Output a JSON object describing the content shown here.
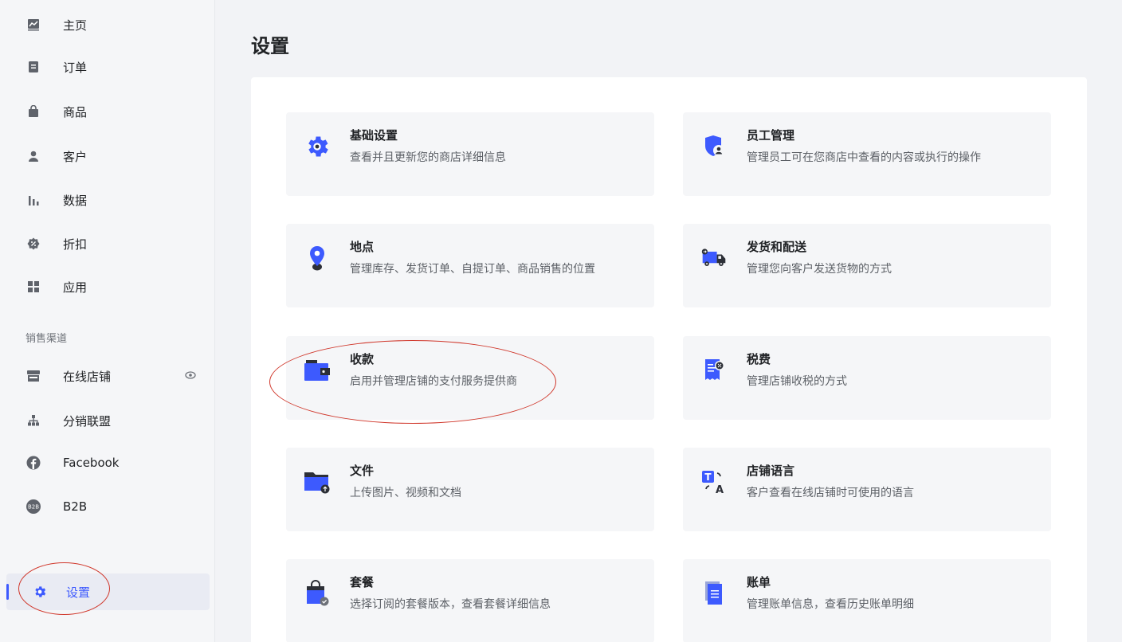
{
  "sidebar": {
    "items": [
      {
        "label": "主页",
        "icon": "chart-icon"
      },
      {
        "label": "订单",
        "icon": "order-icon"
      },
      {
        "label": "商品",
        "icon": "bag-icon"
      },
      {
        "label": "客户",
        "icon": "user-icon"
      },
      {
        "label": "数据",
        "icon": "bar-chart-icon"
      },
      {
        "label": "折扣",
        "icon": "discount-icon"
      },
      {
        "label": "应用",
        "icon": "apps-icon"
      }
    ],
    "section_label": "销售渠道",
    "channels": [
      {
        "label": "在线店铺",
        "icon": "store-icon"
      },
      {
        "label": "分销联盟",
        "icon": "affiliate-icon"
      },
      {
        "label": "Facebook",
        "icon": "facebook-icon"
      },
      {
        "label": "B2B",
        "icon": "b2b-icon"
      }
    ],
    "settings_label": "设置"
  },
  "main": {
    "title": "设置",
    "cards": [
      {
        "title": "基础设置",
        "desc": "查看并且更新您的商店详细信息",
        "icon": "gear-icon"
      },
      {
        "title": "员工管理",
        "desc": "管理员工可在您商店中查看的内容或执行的操作",
        "icon": "staff-shield-icon"
      },
      {
        "title": "地点",
        "desc": "管理库存、发货订单、自提订单、商品销售的位置",
        "icon": "location-pin-icon"
      },
      {
        "title": "发货和配送",
        "desc": "管理您向客户发送货物的方式",
        "icon": "truck-icon"
      },
      {
        "title": "收款",
        "desc": "启用并管理店铺的支付服务提供商",
        "icon": "wallet-icon"
      },
      {
        "title": "税费",
        "desc": "管理店铺收税的方式",
        "icon": "tax-receipt-icon"
      },
      {
        "title": "文件",
        "desc": "上传图片、视频和文档",
        "icon": "folder-upload-icon"
      },
      {
        "title": "店铺语言",
        "desc": "客户查看在线店铺时可使用的语言",
        "icon": "translate-icon"
      },
      {
        "title": "套餐",
        "desc": "选择订阅的套餐版本，查看套餐详细信息",
        "icon": "plan-bag-icon"
      },
      {
        "title": "账单",
        "desc": "管理账单信息，查看历史账单明细",
        "icon": "bill-document-icon"
      }
    ]
  },
  "colors": {
    "accent": "#3d5afe",
    "annotation": "#d0372b",
    "icon_dark": "#2c2f37"
  }
}
